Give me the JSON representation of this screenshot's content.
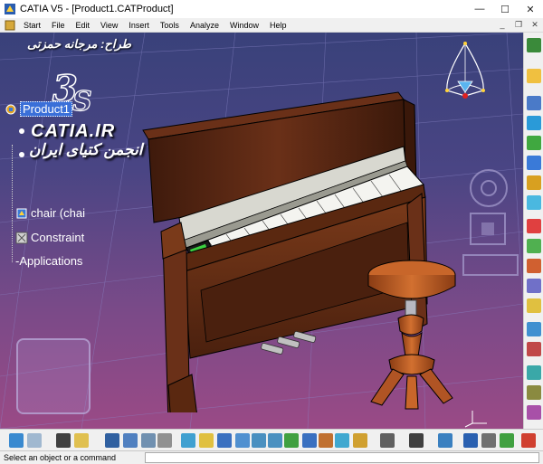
{
  "window": {
    "title": "CATIA V5 - [Product1.CATProduct]",
    "controls": {
      "minimize": "—",
      "maximize": "☐",
      "close": "✕"
    }
  },
  "menu": {
    "items": [
      "Start",
      "File",
      "Edit",
      "View",
      "Insert",
      "Tools",
      "Analyze",
      "Window",
      "Help"
    ],
    "doc_controls": {
      "minimize": "_",
      "restore": "❐",
      "close": "✕"
    }
  },
  "overlay": {
    "designer": "طراح: مرجانه حمزتی",
    "site": "CATIA.IR",
    "association": "انجمن کتیای ایران"
  },
  "tree": {
    "items": [
      {
        "label": "Product1",
        "selected": true
      },
      {
        "label": "",
        "selected": false
      },
      {
        "label": "",
        "selected": false
      },
      {
        "label": "chair (chai",
        "selected": false
      },
      {
        "label": "Constraint",
        "selected": false
      },
      {
        "label": "-Applications",
        "selected": false
      }
    ]
  },
  "status": {
    "prompt": "Select an object or a command",
    "command": ""
  },
  "colors": {
    "selection": "#3a6fd8",
    "wood": "#5a2a14",
    "stool": "#c8662a"
  }
}
